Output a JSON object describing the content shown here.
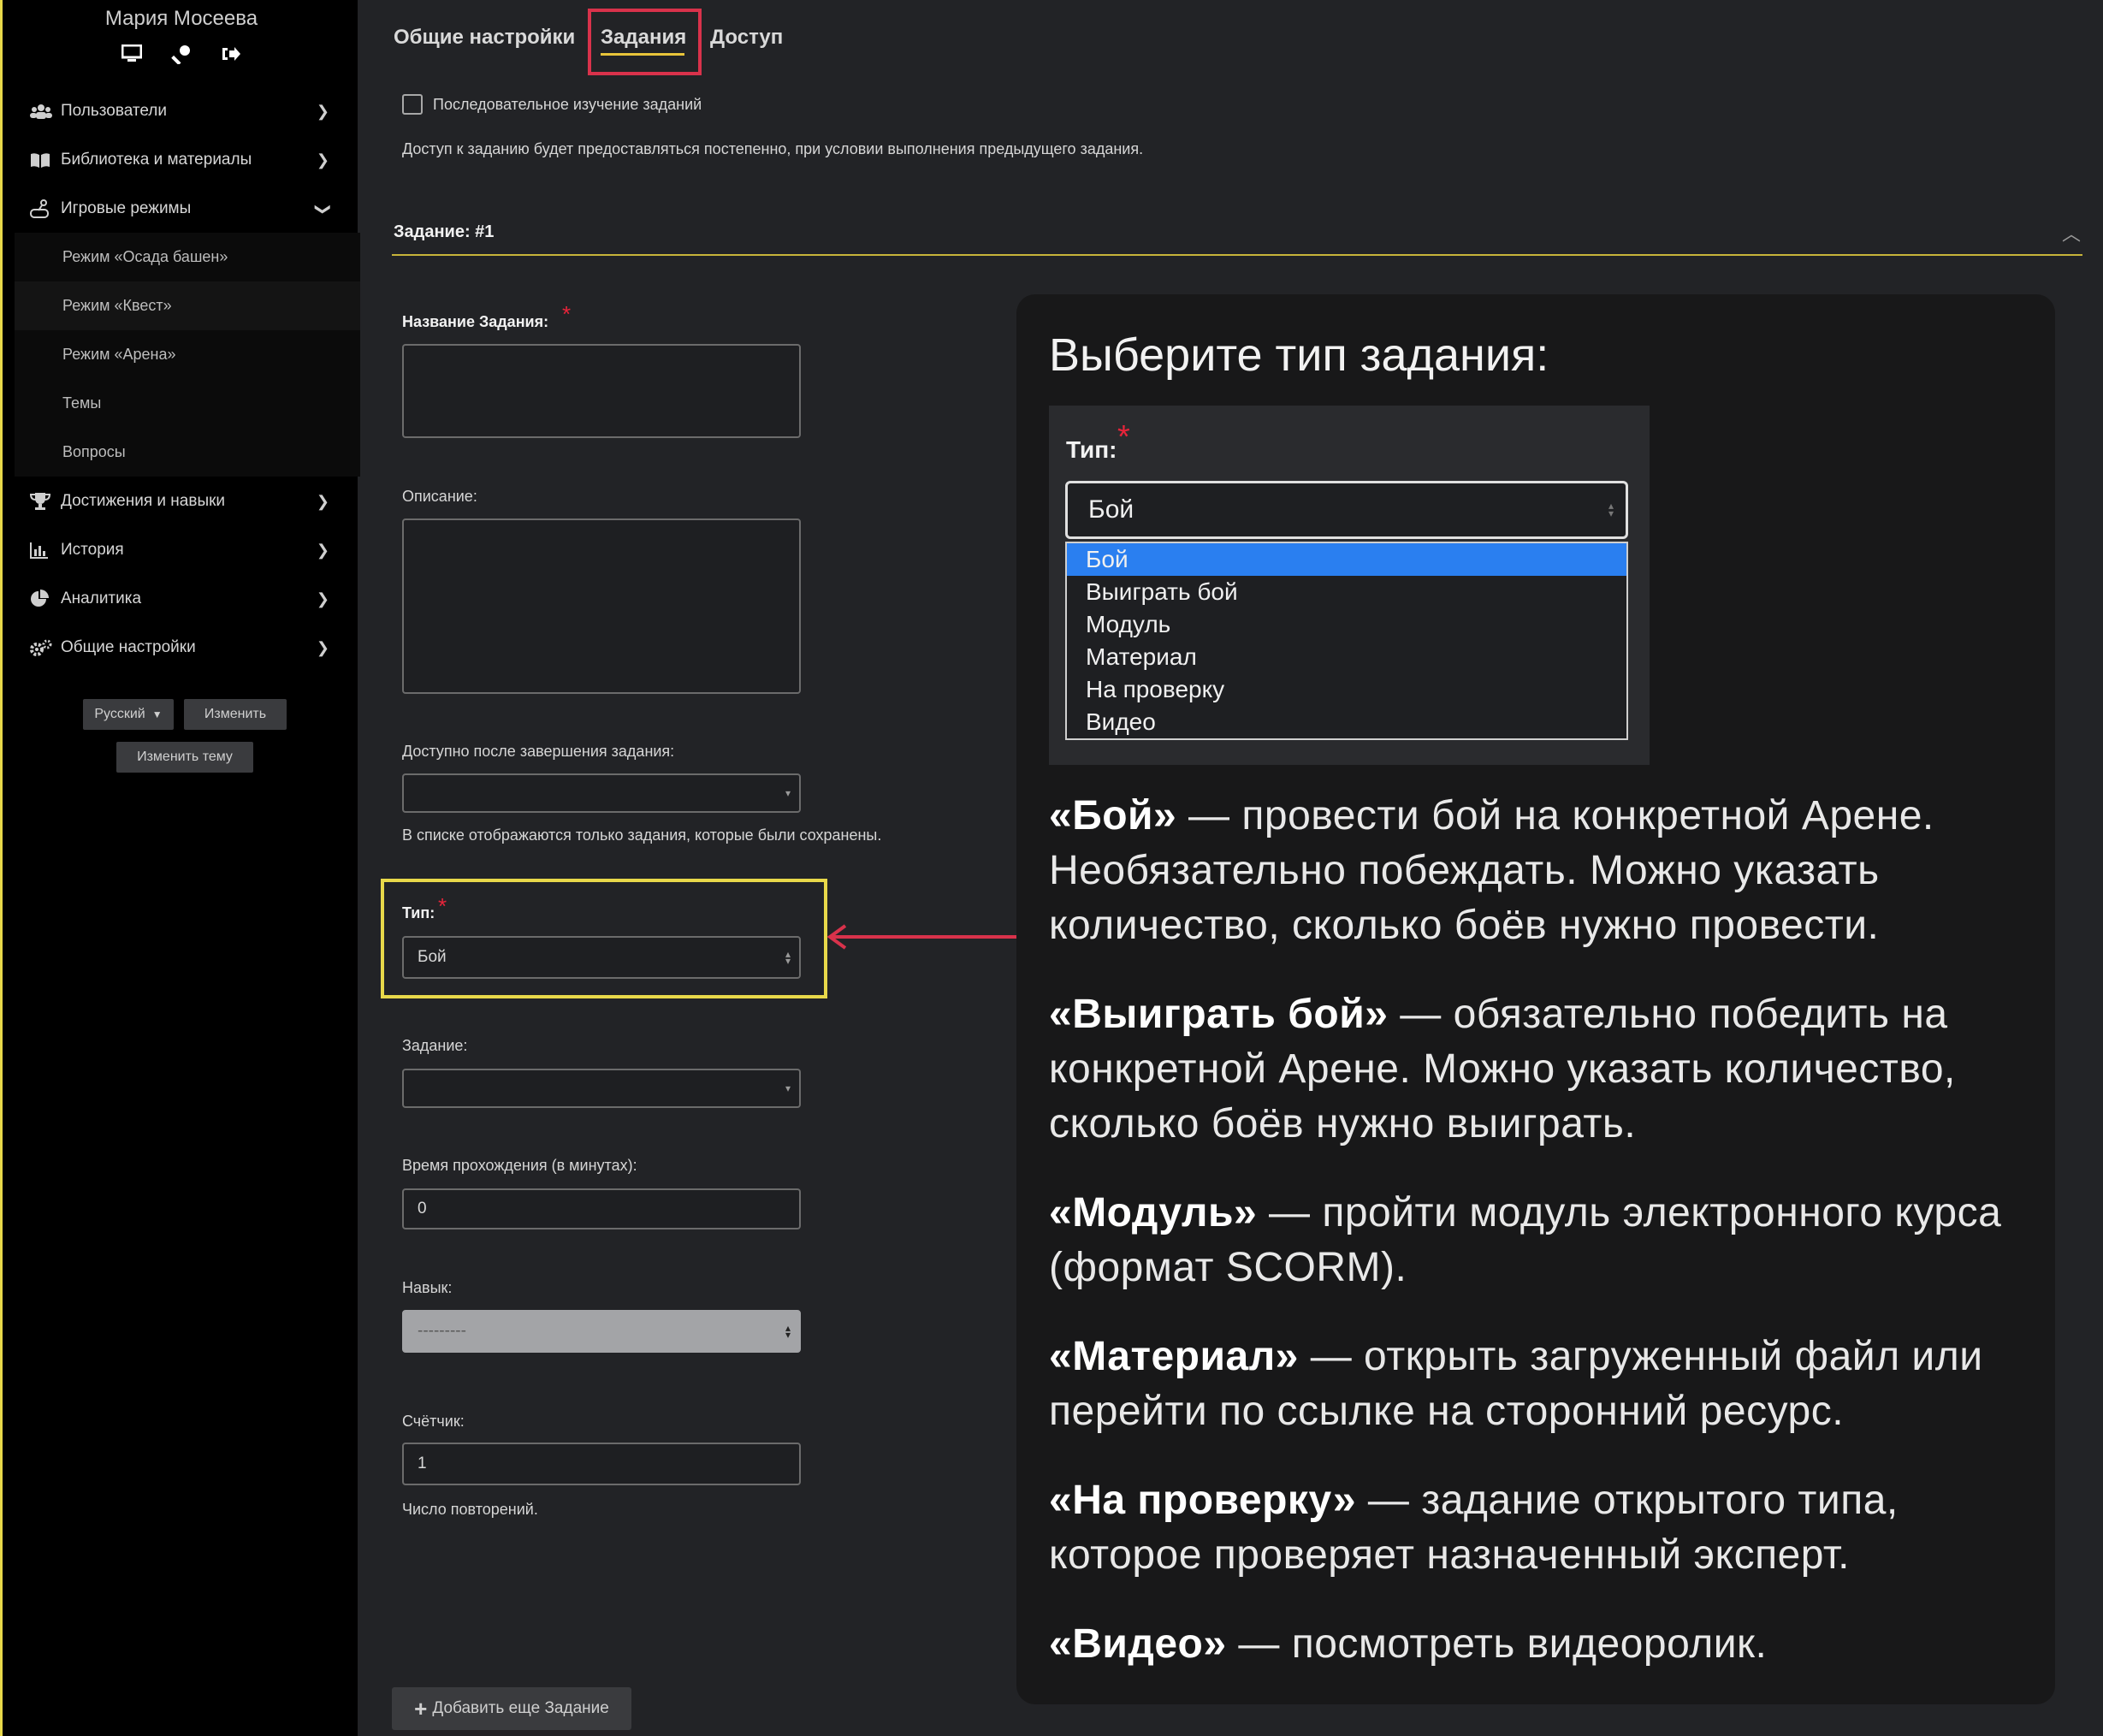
{
  "sidebar": {
    "user_name": "Мария Мосеева",
    "user_icons": [
      "monitor-icon",
      "key-icon",
      "logout-icon"
    ],
    "items": [
      {
        "label": "Пользователи",
        "icon": "users-icon"
      },
      {
        "label": "Библиотека и материалы",
        "icon": "book-icon"
      },
      {
        "label": "Игровые режимы",
        "icon": "gamepad-icon"
      },
      {
        "label": "Достижения и навыки",
        "icon": "trophy-icon"
      },
      {
        "label": "История",
        "icon": "chart-icon"
      },
      {
        "label": "Аналитика",
        "icon": "pie-icon"
      },
      {
        "label": "Общие настройки",
        "icon": "gears-icon"
      }
    ],
    "subitems": [
      "Режим «Осада башен»",
      "Режим «Квест»",
      "Режим «Арена»",
      "Темы",
      "Вопросы"
    ],
    "language": "Русский",
    "change_label": "Изменить",
    "change_theme_label": "Изменить тему"
  },
  "tabs": [
    "Общие настройки",
    "Задания",
    "Доступ"
  ],
  "sequential_label": "Последовательное изучение заданий",
  "sequential_help": "Доступ к заданию будет предоставляться постепенно, при условии выполнения предыдущего задания.",
  "section_title": "Задание: #1",
  "form": {
    "name_label": "Название Задания:",
    "required_mark": "*",
    "description_label": "Описание:",
    "available_after_label": "Доступно после завершения задания:",
    "available_after_help": "В списке отображаются только задания, которые были сохранены.",
    "type_label": "Тип:",
    "type_value": "Бой",
    "task_label": "Задание:",
    "time_label": "Время прохождения (в минутах):",
    "time_value": "0",
    "skill_label": "Навык:",
    "skill_value": "---------",
    "counter_label": "Счётчик:",
    "counter_value": "1",
    "counter_help": "Число повторений.",
    "add_button": "Добавить еще Задание"
  },
  "panel": {
    "title": "Выберите тип задания:",
    "type_label": "Тип:",
    "select_value": "Бой",
    "options": [
      "Бой",
      "Выиграть бой",
      "Модуль",
      "Материал",
      "На проверку",
      "Видео"
    ],
    "descriptions": [
      {
        "term": "«Бой»",
        "text": " — провести бой на конкретной Арене. Необязательно побеждать. Можно указать количество, сколько боёв нужно провести."
      },
      {
        "term": "«Выиграть бой»",
        "text": " — обязательно победить на конкретной Арене. Можно указать количество, сколько боёв нужно выиграть."
      },
      {
        "term": "«Модуль»",
        "text": " — пройти модуль электронного курса (формат SCORM)."
      },
      {
        "term": "«Материал»",
        "text": " — открыть загруженный файл или перейти по ссылке на сторонний ресурс."
      },
      {
        "term": "«На проверку»",
        "text": " — задание открытого типа, которое проверяет назначенный эксперт."
      },
      {
        "term": "«Видео»",
        "text": " — посмотреть видеоролик."
      }
    ]
  },
  "colors": {
    "accent_yellow": "#e8d84a",
    "highlight_red": "#d9324b",
    "select_blue": "#2a7ff0"
  }
}
